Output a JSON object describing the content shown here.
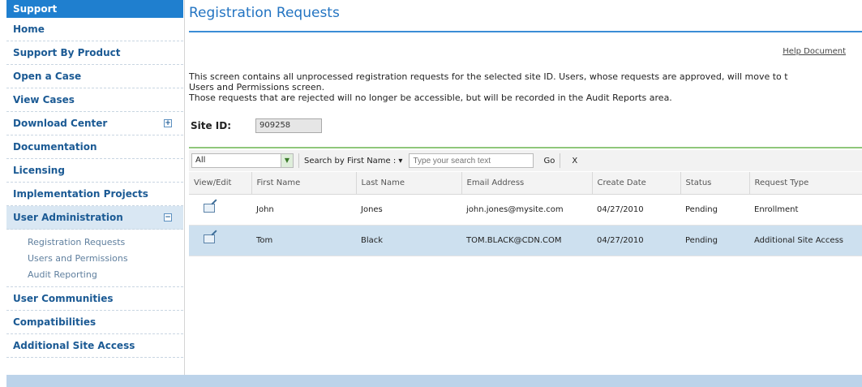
{
  "sidebar": {
    "header": "Support",
    "items_top": [
      {
        "label": "Home"
      },
      {
        "label": "Support By Product"
      },
      {
        "label": "Open a Case"
      },
      {
        "label": "View Cases"
      },
      {
        "label": "Download Center",
        "toggle": "+"
      },
      {
        "label": "Documentation"
      },
      {
        "label": "Licensing"
      },
      {
        "label": "Implementation Projects"
      }
    ],
    "active_item": {
      "label": "User Administration",
      "toggle": "−"
    },
    "sub_items": [
      "Registration Requests",
      "Users and Permissions",
      "Audit Reporting"
    ],
    "items_bottom": [
      {
        "label": "User Communities"
      },
      {
        "label": "Compatibilities"
      },
      {
        "label": "Additional Site Access"
      }
    ]
  },
  "main": {
    "title": "Registration Requests",
    "help_link": "Help Document",
    "intro_lines": [
      "This screen contains all unprocessed registration requests for the selected site ID. Users, whose requests are approved, will move to t",
      "Users and Permissions screen.",
      "Those requests that are rejected will no longer be accessible, but will be recorded in the Audit Reports area."
    ],
    "site_id_label": "Site ID:",
    "site_id_value": "909258"
  },
  "toolbar": {
    "filter_value": "All",
    "search_by_label": "Search by First Name : ▾",
    "search_placeholder": "Type your search text",
    "go_label": "Go",
    "clear_label": "X"
  },
  "table": {
    "columns": [
      "View/Edit",
      "First Name",
      "Last Name",
      "Email Address",
      "Create Date",
      "Status",
      "Request Type"
    ],
    "rows": [
      {
        "first": "John",
        "last": "Jones",
        "email": "john.jones@mysite.com",
        "date": "04/27/2010",
        "status": "Pending",
        "type": "Enrollment",
        "selected": false
      },
      {
        "first": "Tom",
        "last": "Black",
        "email": "TOM.BLACK@CDN.COM",
        "date": "04/27/2010",
        "status": "Pending",
        "type": "Additional Site Access",
        "selected": true
      }
    ]
  },
  "colors": {
    "accent": "#1f7fcf",
    "link": "#1b5a94",
    "selected_row": "#cde0ef",
    "grid_rule": "#8fc77a"
  }
}
